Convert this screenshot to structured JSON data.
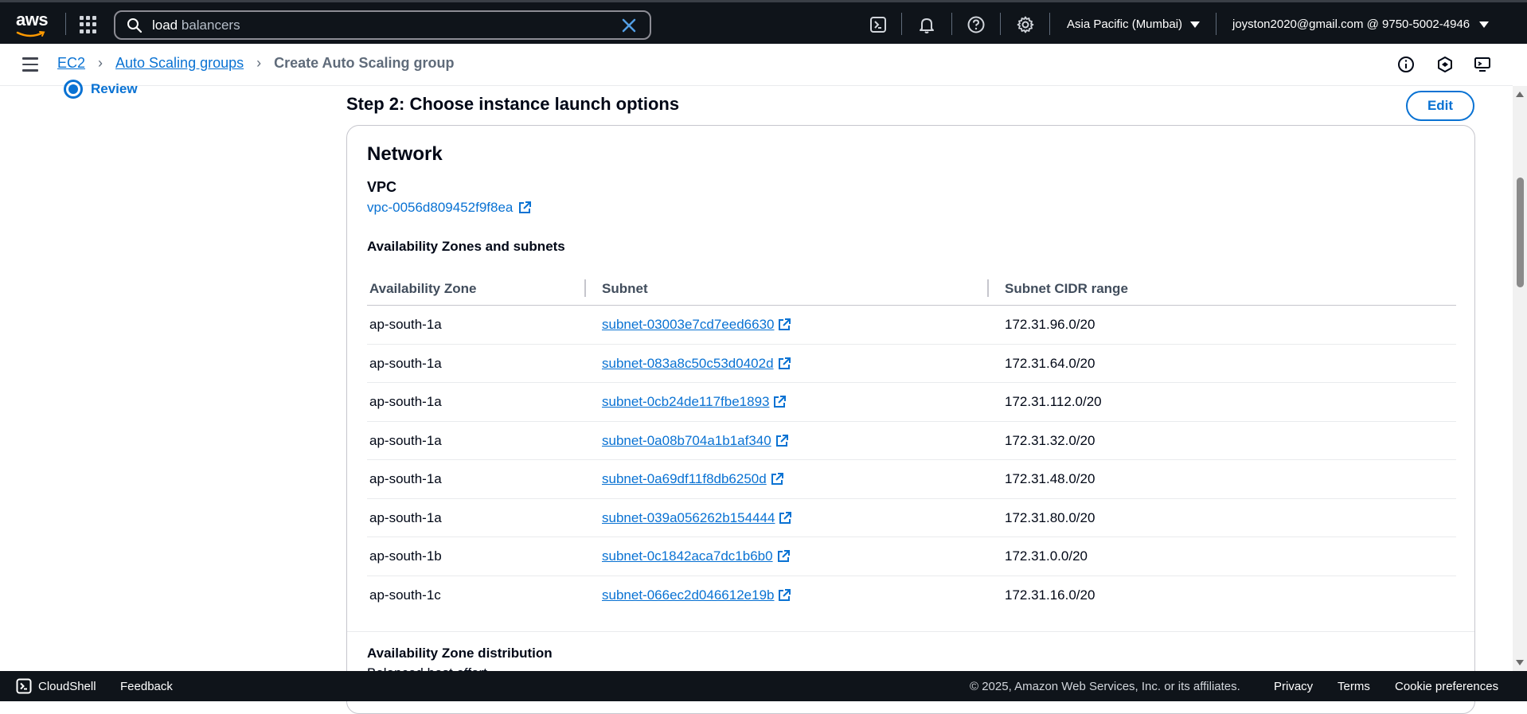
{
  "topnav": {
    "logo_text": "aws",
    "search_value_strong": "load",
    "search_value_rest": " balancers",
    "region": "Asia Pacific (Mumbai)",
    "account": "joyston2020@gmail.com @ 9750-5002-4946"
  },
  "breadcrumb": {
    "items": [
      "EC2",
      "Auto Scaling groups"
    ],
    "current": "Create Auto Scaling group"
  },
  "sidenav": {
    "review_label": "Review"
  },
  "main": {
    "step_title": "Step 2: Choose instance launch options",
    "edit_label": "Edit",
    "network_title": "Network",
    "vpc_label": "VPC",
    "vpc_id": "vpc-0056d809452f9f8ea",
    "az_subnets_label": "Availability Zones and subnets",
    "columns": [
      "Availability Zone",
      "Subnet",
      "Subnet CIDR range"
    ],
    "rows": [
      {
        "az": "ap-south-1a",
        "subnet": "subnet-03003e7cd7eed6630",
        "cidr": "172.31.96.0/20"
      },
      {
        "az": "ap-south-1a",
        "subnet": "subnet-083a8c50c53d0402d",
        "cidr": "172.31.64.0/20"
      },
      {
        "az": "ap-south-1a",
        "subnet": "subnet-0cb24de117fbe1893",
        "cidr": "172.31.112.0/20"
      },
      {
        "az": "ap-south-1a",
        "subnet": "subnet-0a08b704a1b1af340",
        "cidr": "172.31.32.0/20"
      },
      {
        "az": "ap-south-1a",
        "subnet": "subnet-0a69df11f8db6250d",
        "cidr": "172.31.48.0/20"
      },
      {
        "az": "ap-south-1a",
        "subnet": "subnet-039a056262b154444",
        "cidr": "172.31.80.0/20"
      },
      {
        "az": "ap-south-1b",
        "subnet": "subnet-0c1842aca7dc1b6b0",
        "cidr": "172.31.0.0/20"
      },
      {
        "az": "ap-south-1c",
        "subnet": "subnet-066ec2d046612e19b",
        "cidr": "172.31.16.0/20"
      }
    ],
    "az_distribution_label": "Availability Zone distribution",
    "az_distribution_value": "Balanced best effort"
  },
  "footer": {
    "cloudshell": "CloudShell",
    "feedback": "Feedback",
    "copyright": "© 2025, Amazon Web Services, Inc. or its affiliates.",
    "privacy": "Privacy",
    "terms": "Terms",
    "cookies": "Cookie preferences"
  },
  "colors": {
    "nav_bg": "#0f141a",
    "link": "#0972d3",
    "text": "#000716"
  }
}
